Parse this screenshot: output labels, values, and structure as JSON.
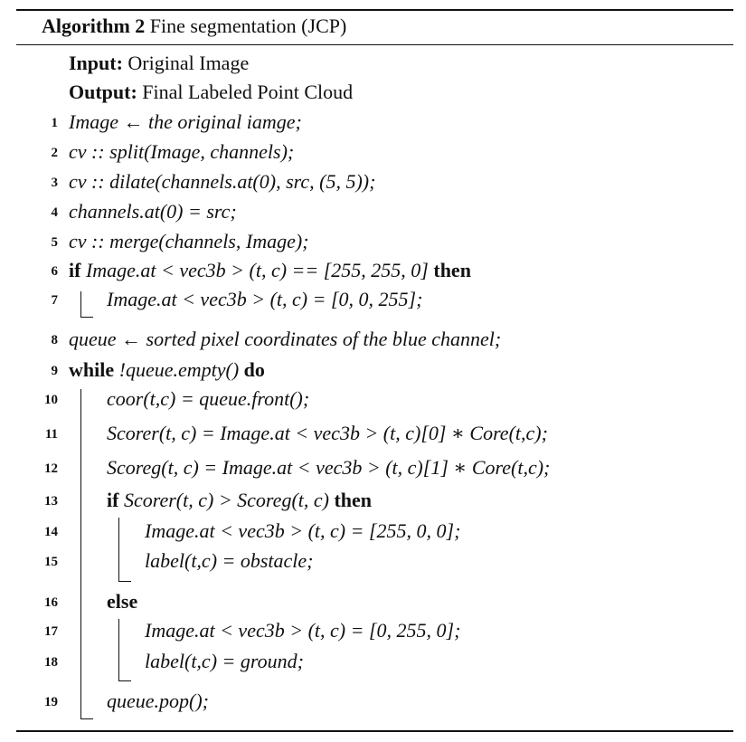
{
  "caption": {
    "label": "Algorithm 2",
    "title": "Fine segmentation (JCP)"
  },
  "io": {
    "input_label": "Input:",
    "input_value": "Original Image",
    "output_label": "Output:",
    "output_value": "Final Labeled Point Cloud"
  },
  "lines": [
    {
      "no": "1",
      "kw_before": "",
      "text": "Image ← the original iamge;",
      "kw_after": ""
    },
    {
      "no": "2",
      "kw_before": "",
      "text": "cv :: split(Image, channels);",
      "kw_after": ""
    },
    {
      "no": "3",
      "kw_before": "",
      "text": "cv :: dilate(channels.at(0), src, (5, 5));",
      "kw_after": ""
    },
    {
      "no": "4",
      "kw_before": "",
      "text": "channels.at(0) = src;",
      "kw_after": ""
    },
    {
      "no": "5",
      "kw_before": "",
      "text": "cv :: merge(channels, Image);",
      "kw_after": ""
    },
    {
      "no": "6",
      "kw_before": "if",
      "text": "Image.at < vec3b > (t, c) == [255, 255, 0]",
      "kw_after": "then"
    },
    {
      "no": "7",
      "kw_before": "",
      "text": "Image.at < vec3b > (t, c) = [0, 0, 255];",
      "kw_after": ""
    },
    {
      "no": "8",
      "kw_before": "",
      "text": "queue ← sorted pixel coordinates of the blue channel;",
      "kw_after": ""
    },
    {
      "no": "9",
      "kw_before": "while",
      "text": "!queue.empty()",
      "kw_after": "do"
    },
    {
      "no": "10",
      "kw_before": "",
      "text": "coor(t,c) = queue.front();",
      "kw_after": ""
    },
    {
      "no": "11",
      "kw_before": "",
      "text": "Scorer(t, c) = Image.at < vec3b > (t, c)[0] ∗ Core(t,c);",
      "kw_after": ""
    },
    {
      "no": "12",
      "kw_before": "",
      "text": "Scoreg(t, c) = Image.at < vec3b > (t, c)[1] ∗ Core(t,c);",
      "kw_after": ""
    },
    {
      "no": "13",
      "kw_before": "if",
      "text": "Scorer(t, c) > Scoreg(t, c)",
      "kw_after": "then"
    },
    {
      "no": "14",
      "kw_before": "",
      "text": "Image.at < vec3b > (t, c) = [255, 0, 0];",
      "kw_after": ""
    },
    {
      "no": "15",
      "kw_before": "",
      "text": "label(t,c) = obstacle;",
      "kw_after": ""
    },
    {
      "no": "16",
      "kw_before": "else",
      "text": "",
      "kw_after": ""
    },
    {
      "no": "17",
      "kw_before": "",
      "text": "Image.at < vec3b > (t, c) = [0, 255, 0];",
      "kw_after": ""
    },
    {
      "no": "18",
      "kw_before": "",
      "text": "label(t,c) = ground;",
      "kw_after": ""
    },
    {
      "no": "19",
      "kw_before": "",
      "text": "queue.pop();",
      "kw_after": ""
    }
  ]
}
